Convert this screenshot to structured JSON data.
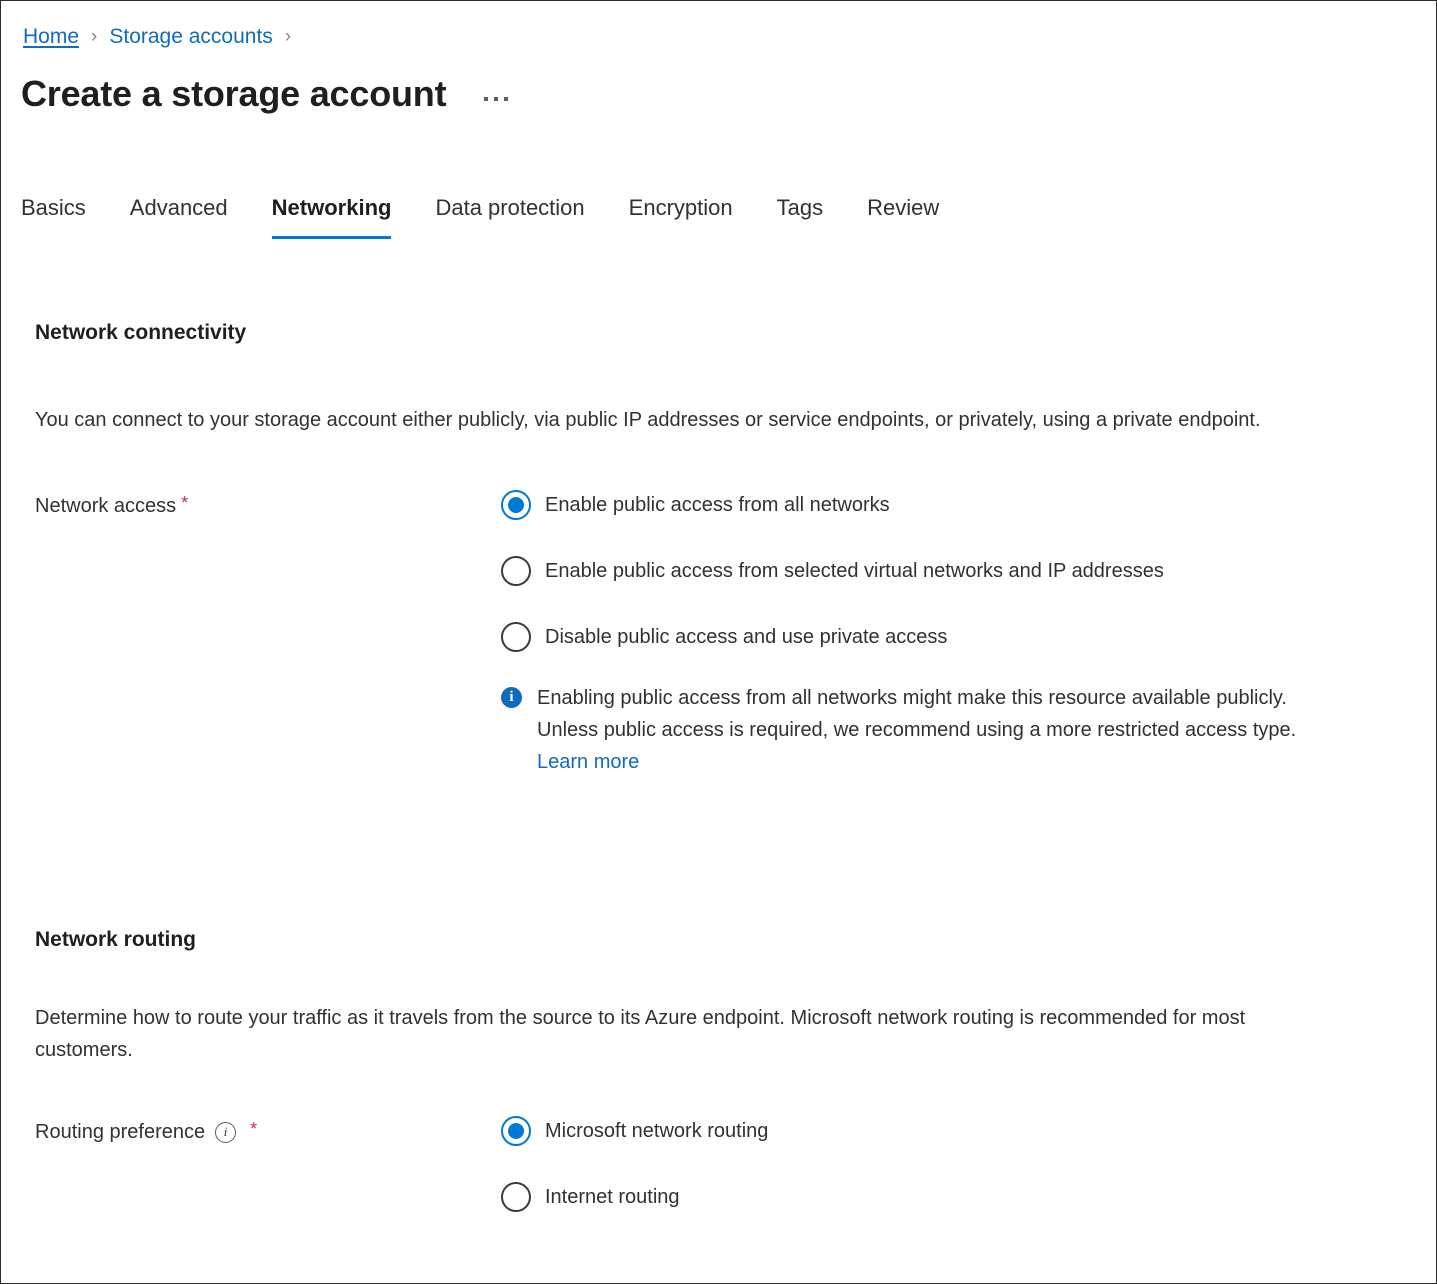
{
  "breadcrumb": {
    "items": [
      {
        "label": "Home",
        "state": "hover"
      },
      {
        "label": "Storage accounts",
        "state": "normal"
      }
    ],
    "separator": "›"
  },
  "header": {
    "title": "Create a storage account",
    "more_actions_label": "More actions"
  },
  "tabs": [
    {
      "label": "Basics",
      "active": false
    },
    {
      "label": "Advanced",
      "active": false
    },
    {
      "label": "Networking",
      "active": true
    },
    {
      "label": "Data protection",
      "active": false
    },
    {
      "label": "Encryption",
      "active": false
    },
    {
      "label": "Tags",
      "active": false
    },
    {
      "label": "Review",
      "active": false
    }
  ],
  "sections": {
    "connectivity": {
      "heading": "Network connectivity",
      "description": "You can connect to your storage account either publicly, via public IP addresses or service endpoints, or privately, using a private endpoint.",
      "field": {
        "label": "Network access",
        "required_mark": "*",
        "options": [
          {
            "label": "Enable public access from all networks",
            "checked": true
          },
          {
            "label": "Enable public access from selected virtual networks and IP addresses",
            "checked": false
          },
          {
            "label": "Disable public access and use private access",
            "checked": false
          }
        ]
      },
      "info": {
        "icon": "info-filled-icon",
        "text": "Enabling public access from all networks might make this resource available publicly. Unless public access is required, we recommend using a more restricted access type. ",
        "link_label": "Learn more"
      }
    },
    "routing": {
      "heading": "Network routing",
      "description": "Determine how to route your traffic as it travels from the source to its Azure endpoint. Microsoft network routing is recommended for most customers.",
      "field": {
        "label": "Routing preference",
        "info_icon": "info-outline-icon",
        "required_mark": "*",
        "options": [
          {
            "label": "Microsoft network routing",
            "checked": true
          },
          {
            "label": "Internet routing",
            "checked": false
          }
        ]
      }
    }
  },
  "colors": {
    "accent": "#0078d4",
    "link": "#0f6cbd",
    "required": "#c4314b",
    "text": "#323130"
  }
}
